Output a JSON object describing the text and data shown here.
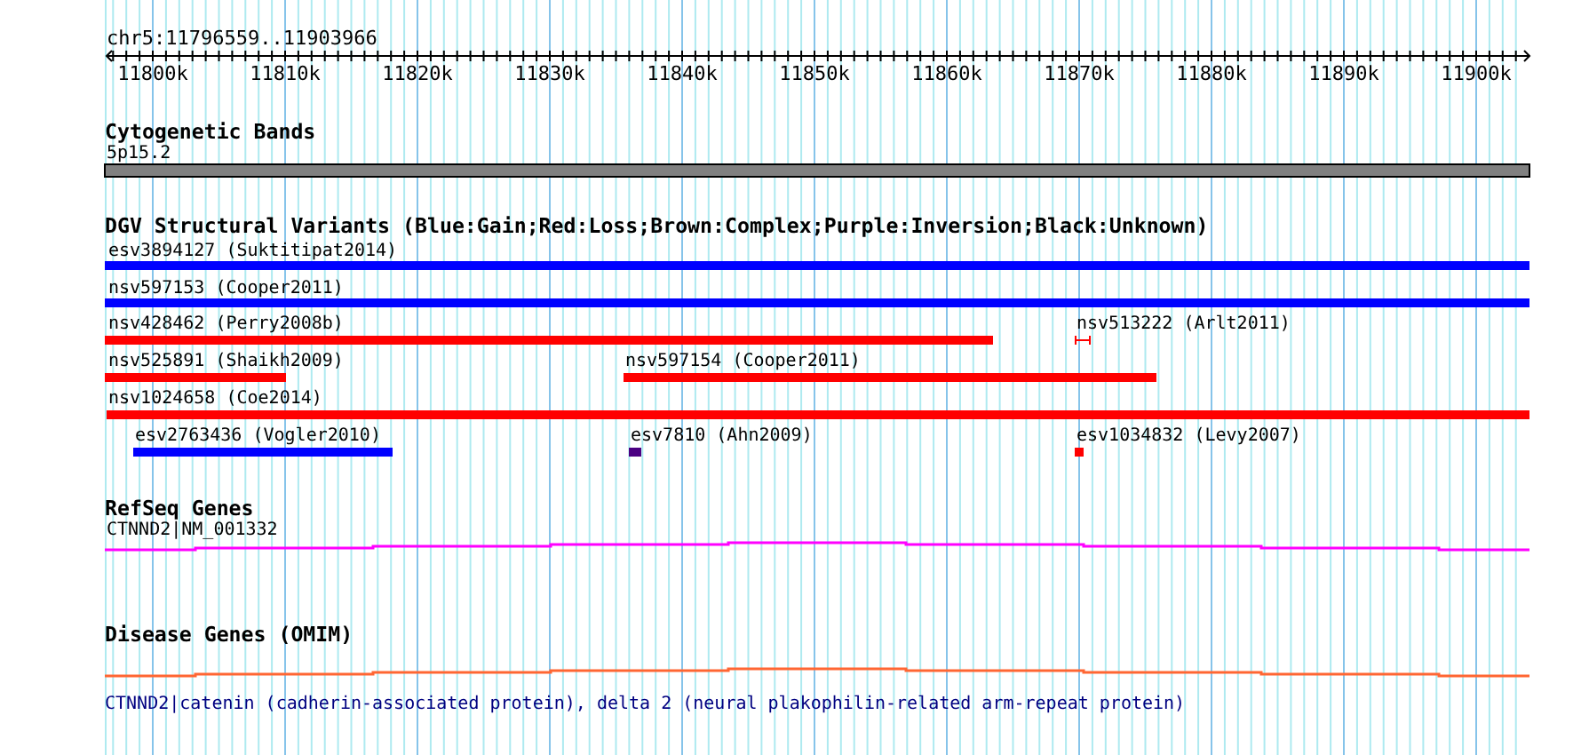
{
  "ruler": {
    "region": "chr5:11796559..11903966",
    "ticks": [
      "11800k",
      "11810k",
      "11820k",
      "11830k",
      "11840k",
      "11850k",
      "11860k",
      "11870k",
      "11880k",
      "11890k",
      "11900k"
    ]
  },
  "tracks": [
    {
      "title": "Cytogenetic Bands",
      "kind": "bands",
      "features": [
        {
          "label": "5p15.2"
        }
      ]
    },
    {
      "title": "DGV Structural Variants (Blue:Gain;Red:Loss;Brown:Complex;Purple:Inversion;Black:Unknown)",
      "kind": "variants",
      "features": [
        {
          "label": "esv3894127 (Suktitipat2014)",
          "color": "#0000ff"
        },
        {
          "label": "nsv597153 (Cooper2011)",
          "color": "#0000ff"
        },
        {
          "label": "nsv428462 (Perry2008b)",
          "color": "#ff0000"
        },
        {
          "label": "nsv513222 (Arlt2011)",
          "color": "#ff0000"
        },
        {
          "label": "nsv525891 (Shaikh2009)",
          "color": "#ff0000"
        },
        {
          "label": "nsv597154 (Cooper2011)",
          "color": "#ff0000"
        },
        {
          "label": "nsv1024658 (Coe2014)",
          "color": "#ff0000"
        },
        {
          "label": "esv2763436 (Vogler2010)",
          "color": "#0000ff"
        },
        {
          "label": "esv7810 (Ahn2009)",
          "color": "#4b0082"
        },
        {
          "label": "esv1034832 (Levy2007)",
          "color": "#ff0000"
        }
      ]
    },
    {
      "title": "RefSeq Genes",
      "kind": "gene",
      "features": [
        {
          "label": "CTNND2|NM_001332"
        }
      ]
    },
    {
      "title": "Disease Genes (OMIM)",
      "kind": "omim",
      "features": [
        {
          "label": "CTNND2|catenin (cadherin-associated protein), delta 2 (neural plakophilin-related arm-repeat protein)"
        }
      ]
    }
  ]
}
